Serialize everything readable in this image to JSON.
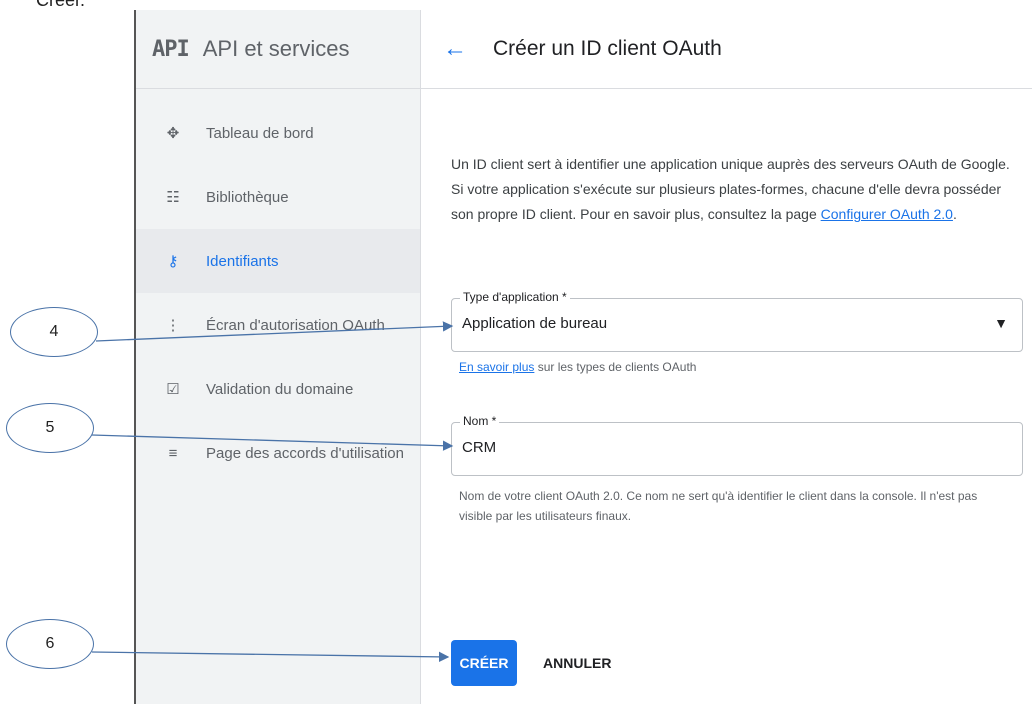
{
  "caption": {
    "text": "Créer."
  },
  "sidebar": {
    "logo": "API",
    "title": "API et services",
    "items": [
      {
        "label": "Tableau de bord",
        "icon": "dashboard-icon"
      },
      {
        "label": "Bibliothèque",
        "icon": "library-icon"
      },
      {
        "label": "Identifiants",
        "icon": "key-icon",
        "active": true
      },
      {
        "label": "Écran d'autorisation OAuth",
        "icon": "consent-screen-icon"
      },
      {
        "label": "Validation du domaine",
        "icon": "domain-verification-icon"
      },
      {
        "label": "Page des accords d'utilisation",
        "icon": "agreements-icon"
      }
    ]
  },
  "header": {
    "title": "Créer un ID client OAuth"
  },
  "intro": {
    "text": "Un ID client sert à identifier une application unique auprès des serveurs OAuth de Google. Si votre application s'exécute sur plusieurs plates-formes, chacune d'elle devra posséder son propre ID client. Pour en savoir plus, consultez la page ",
    "link": "Configurer OAuth 2.0",
    "end": "."
  },
  "form": {
    "app_type": {
      "label": "Type d'application *",
      "value": "Application de bureau",
      "help_link": "En savoir plus",
      "help_text": " sur les types de clients OAuth"
    },
    "name": {
      "label": "Nom *",
      "value": "CRM",
      "help": "Nom de votre client OAuth 2.0. Ce nom ne sert qu'à identifier le client dans la console. Il n'est pas visible par les utilisateurs finaux."
    }
  },
  "buttons": {
    "create": "CRÉER",
    "cancel": "ANNULER"
  },
  "callouts": [
    "4",
    "5",
    "6"
  ],
  "colors": {
    "accent": "#1a73e8",
    "callout_line": "#4a73a8"
  }
}
